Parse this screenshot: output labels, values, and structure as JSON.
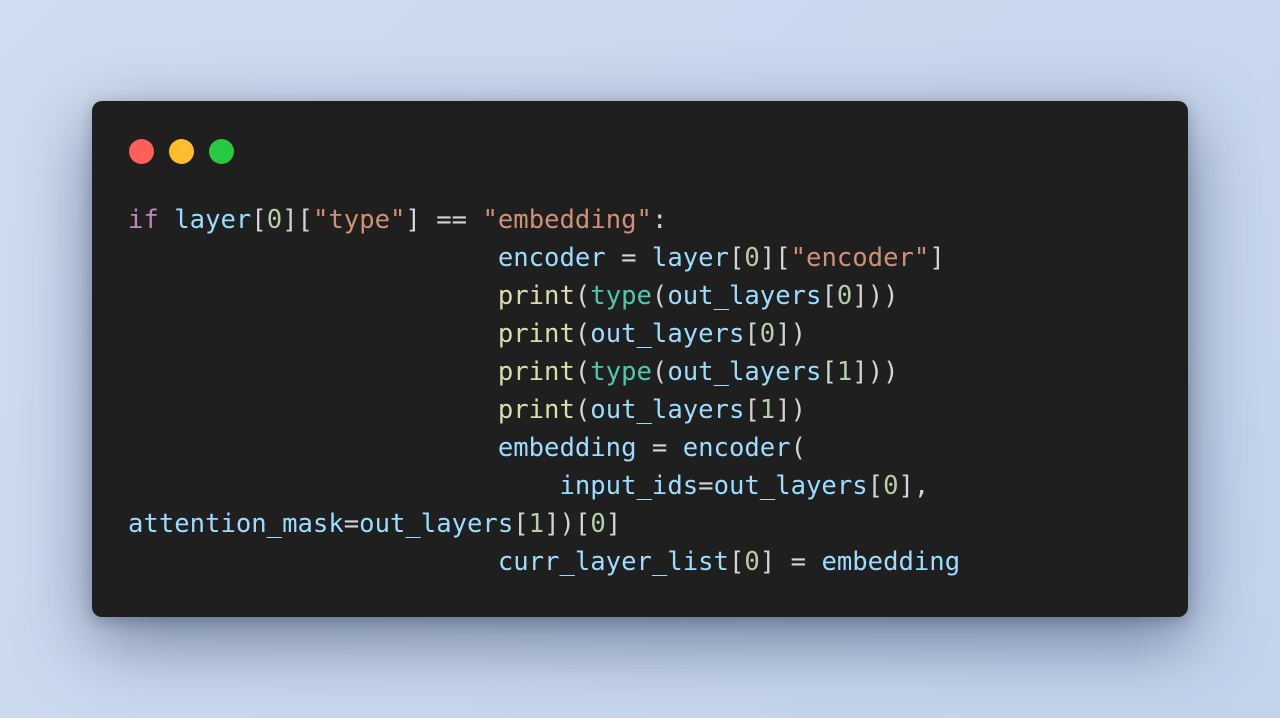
{
  "window": {
    "controls": [
      {
        "name": "close",
        "color": "#ff5f56"
      },
      {
        "name": "minimize",
        "color": "#ffbd2e"
      },
      {
        "name": "maximize",
        "color": "#27c93f"
      }
    ]
  },
  "theme": {
    "background": "#1f1f1f",
    "keyword": "#c586c0",
    "variable": "#9cdcfe",
    "number": "#b5cea8",
    "string": "#ce9178",
    "function": "#dcdcaa",
    "builtin_type": "#4ec9b0",
    "punctuation": "#d4d4d4"
  },
  "code": {
    "lines": [
      [
        {
          "t": "if",
          "k": "keyword"
        },
        {
          "t": " ",
          "k": "punctuation"
        },
        {
          "t": "layer",
          "k": "variable"
        },
        {
          "t": "[",
          "k": "punctuation"
        },
        {
          "t": "0",
          "k": "number"
        },
        {
          "t": "][",
          "k": "punctuation"
        },
        {
          "t": "\"type\"",
          "k": "string"
        },
        {
          "t": "] == ",
          "k": "punctuation"
        },
        {
          "t": "\"embedding\"",
          "k": "string"
        },
        {
          "t": ":",
          "k": "punctuation"
        }
      ],
      [
        {
          "t": "                        ",
          "k": "punctuation"
        },
        {
          "t": "encoder",
          "k": "variable"
        },
        {
          "t": " = ",
          "k": "punctuation"
        },
        {
          "t": "layer",
          "k": "variable"
        },
        {
          "t": "[",
          "k": "punctuation"
        },
        {
          "t": "0",
          "k": "number"
        },
        {
          "t": "][",
          "k": "punctuation"
        },
        {
          "t": "\"encoder\"",
          "k": "string"
        },
        {
          "t": "]",
          "k": "punctuation"
        }
      ],
      [
        {
          "t": "                        ",
          "k": "punctuation"
        },
        {
          "t": "print",
          "k": "function"
        },
        {
          "t": "(",
          "k": "punctuation"
        },
        {
          "t": "type",
          "k": "builtin_type"
        },
        {
          "t": "(",
          "k": "punctuation"
        },
        {
          "t": "out_layers",
          "k": "variable"
        },
        {
          "t": "[",
          "k": "punctuation"
        },
        {
          "t": "0",
          "k": "number"
        },
        {
          "t": "]))",
          "k": "punctuation"
        }
      ],
      [
        {
          "t": "                        ",
          "k": "punctuation"
        },
        {
          "t": "print",
          "k": "function"
        },
        {
          "t": "(",
          "k": "punctuation"
        },
        {
          "t": "out_layers",
          "k": "variable"
        },
        {
          "t": "[",
          "k": "punctuation"
        },
        {
          "t": "0",
          "k": "number"
        },
        {
          "t": "])",
          "k": "punctuation"
        }
      ],
      [
        {
          "t": "                        ",
          "k": "punctuation"
        },
        {
          "t": "print",
          "k": "function"
        },
        {
          "t": "(",
          "k": "punctuation"
        },
        {
          "t": "type",
          "k": "builtin_type"
        },
        {
          "t": "(",
          "k": "punctuation"
        },
        {
          "t": "out_layers",
          "k": "variable"
        },
        {
          "t": "[",
          "k": "punctuation"
        },
        {
          "t": "1",
          "k": "number"
        },
        {
          "t": "]))",
          "k": "punctuation"
        }
      ],
      [
        {
          "t": "                        ",
          "k": "punctuation"
        },
        {
          "t": "print",
          "k": "function"
        },
        {
          "t": "(",
          "k": "punctuation"
        },
        {
          "t": "out_layers",
          "k": "variable"
        },
        {
          "t": "[",
          "k": "punctuation"
        },
        {
          "t": "1",
          "k": "number"
        },
        {
          "t": "])",
          "k": "punctuation"
        }
      ],
      [
        {
          "t": "                        ",
          "k": "punctuation"
        },
        {
          "t": "embedding",
          "k": "variable"
        },
        {
          "t": " = ",
          "k": "punctuation"
        },
        {
          "t": "encoder",
          "k": "variable"
        },
        {
          "t": "(",
          "k": "punctuation"
        }
      ],
      [
        {
          "t": "                            ",
          "k": "punctuation"
        },
        {
          "t": "input_ids",
          "k": "variable"
        },
        {
          "t": "=",
          "k": "punctuation"
        },
        {
          "t": "out_layers",
          "k": "variable"
        },
        {
          "t": "[",
          "k": "punctuation"
        },
        {
          "t": "0",
          "k": "number"
        },
        {
          "t": "],",
          "k": "punctuation"
        }
      ],
      [
        {
          "t": "attention_mask",
          "k": "variable"
        },
        {
          "t": "=",
          "k": "punctuation"
        },
        {
          "t": "out_layers",
          "k": "variable"
        },
        {
          "t": "[",
          "k": "punctuation"
        },
        {
          "t": "1",
          "k": "number"
        },
        {
          "t": "])[",
          "k": "punctuation"
        },
        {
          "t": "0",
          "k": "number"
        },
        {
          "t": "]",
          "k": "punctuation"
        }
      ],
      [
        {
          "t": "                        ",
          "k": "punctuation"
        },
        {
          "t": "curr_layer_list",
          "k": "variable"
        },
        {
          "t": "[",
          "k": "punctuation"
        },
        {
          "t": "0",
          "k": "number"
        },
        {
          "t": "] = ",
          "k": "punctuation"
        },
        {
          "t": "embedding",
          "k": "variable"
        }
      ]
    ]
  }
}
